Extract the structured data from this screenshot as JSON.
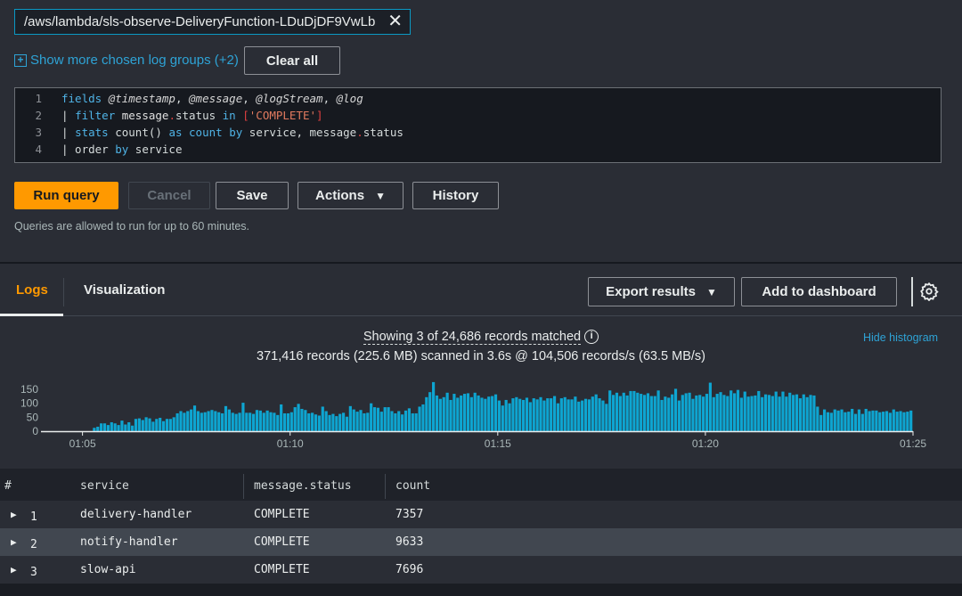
{
  "log_group": {
    "value": "/aws/lambda/sls-observe-DeliveryFunction-LDuDjDF9VwLb",
    "remove_icon": "close-icon"
  },
  "show_more": "Show more chosen log groups (+2)",
  "clear_all": "Clear all",
  "query_lines": [
    {
      "num": "1",
      "text": "fields @timestamp, @message, @logStream, @log"
    },
    {
      "num": "2",
      "text": "| filter message.status in ['COMPLETE']"
    },
    {
      "num": "3",
      "text": "| stats count() as count by service, message.status"
    },
    {
      "num": "4",
      "text": "| order by service"
    }
  ],
  "buttons": {
    "run": "Run query",
    "cancel": "Cancel",
    "save": "Save",
    "actions": "Actions",
    "history": "History"
  },
  "note": "Queries are allowed to run for up to 60 minutes.",
  "tabs": [
    {
      "label": "Logs",
      "active": true
    },
    {
      "label": "Visualization",
      "active": false
    }
  ],
  "results_actions": {
    "export": "Export results",
    "add_dashboard": "Add to dashboard"
  },
  "summary": {
    "showing": "Showing 3 of 24,686 records matched",
    "scanned": "371,416 records (225.6 MB) scanned in 3.6s @ 104,506 records/s (63.5 MB/s)",
    "hide_histogram": "Hide histogram"
  },
  "colors": {
    "accent": "#ff9900",
    "bar": "#0ea5d1",
    "link": "#2ea3d6"
  },
  "chart_data": {
    "type": "bar",
    "xlim": [
      "01:04",
      "01:25"
    ],
    "x_ticks": [
      "01:05",
      "01:10",
      "01:15",
      "01:20",
      "01:25"
    ],
    "ylim": [
      0,
      175
    ],
    "y_ticks": [
      "0",
      "50",
      "100",
      "150"
    ],
    "bin_seconds": 5,
    "start": "01:05:00",
    "values": [
      0,
      0,
      0,
      12,
      16,
      28,
      28,
      22,
      32,
      28,
      22,
      38,
      24,
      32,
      20,
      44,
      46,
      40,
      50,
      46,
      34,
      44,
      48,
      36,
      44,
      44,
      50,
      64,
      72,
      66,
      72,
      78,
      92,
      72,
      66,
      68,
      72,
      76,
      72,
      68,
      64,
      90,
      78,
      66,
      62,
      66,
      102,
      66,
      66,
      62,
      76,
      74,
      66,
      74,
      68,
      66,
      58,
      96,
      64,
      64,
      68,
      86,
      98,
      80,
      76,
      64,
      66,
      60,
      56,
      88,
      72,
      58,
      62,
      54,
      62,
      66,
      52,
      90,
      78,
      70,
      76,
      64,
      66,
      100,
      86,
      84,
      70,
      86,
      86,
      72,
      64,
      72,
      60,
      74,
      82,
      64,
      64,
      88,
      96,
      122,
      140,
      176,
      128,
      116,
      122,
      138,
      112,
      134,
      120,
      128,
      134,
      136,
      122,
      138,
      128,
      120,
      116,
      124,
      126,
      132,
      110,
      92,
      112,
      100,
      118,
      122,
      116,
      112,
      120,
      104,
      118,
      114,
      122,
      110,
      118,
      118,
      126,
      100,
      118,
      122,
      114,
      114,
      124,
      106,
      110,
      116,
      114,
      124,
      132,
      118,
      110,
      98,
      146,
      130,
      138,
      126,
      138,
      128,
      144,
      144,
      138,
      134,
      130,
      136,
      126,
      126,
      146,
      112,
      124,
      120,
      132,
      152,
      110,
      130,
      136,
      138,
      116,
      128,
      130,
      124,
      134,
      174,
      122,
      134,
      140,
      130,
      126,
      146,
      136,
      148,
      120,
      142,
      124,
      126,
      128,
      144,
      122,
      132,
      130,
      126,
      142,
      124,
      142,
      124,
      138,
      130,
      132,
      118,
      132,
      122,
      130,
      128,
      88,
      58,
      78,
      68,
      66,
      78,
      74,
      78,
      68,
      70,
      80,
      62,
      78,
      62,
      80,
      72,
      74,
      74,
      68,
      70,
      72,
      66,
      78,
      70,
      72,
      68,
      70,
      74
    ]
  },
  "table": {
    "headers": [
      "#",
      "service",
      "message.status",
      "count"
    ],
    "rows": [
      {
        "num": "1",
        "service": "delivery-handler",
        "status": "COMPLETE",
        "count": "7357"
      },
      {
        "num": "2",
        "service": "notify-handler",
        "status": "COMPLETE",
        "count": "9633"
      },
      {
        "num": "3",
        "service": "slow-api",
        "status": "COMPLETE",
        "count": "7696"
      }
    ]
  }
}
